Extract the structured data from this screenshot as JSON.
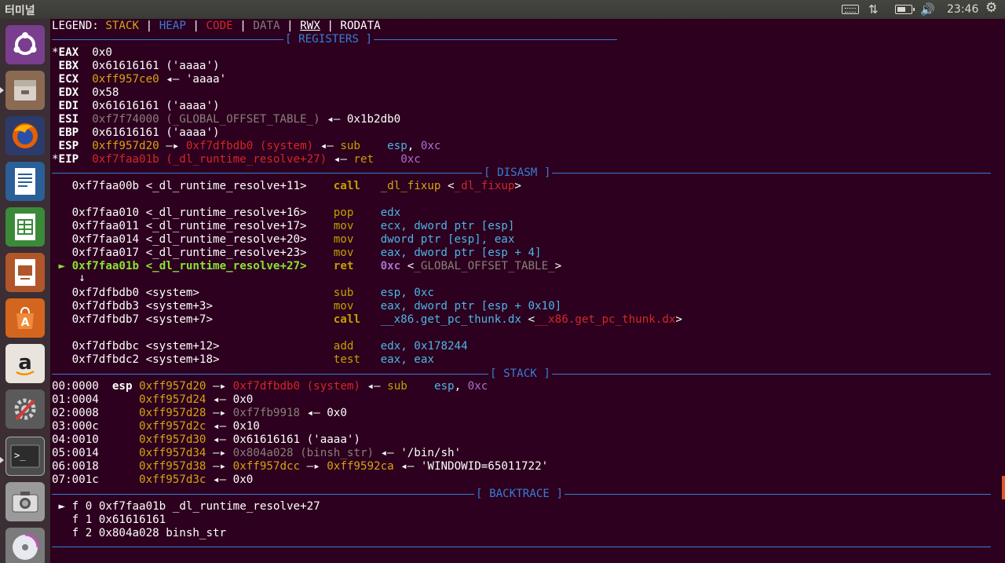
{
  "topbar": {
    "app_title": "터미널",
    "clock": "23:46",
    "icons": [
      "keyboard-icon",
      "network-icon",
      "battery-icon",
      "volume-icon",
      "gear-icon"
    ]
  },
  "launcher": {
    "items": [
      "ubuntu-logo",
      "files",
      "firefox",
      "writer",
      "calc",
      "impress",
      "software-center",
      "amazon",
      "system-settings",
      "terminal",
      "screenshot",
      "dvd"
    ]
  },
  "terminal": {
    "legend": {
      "prefix": "LEGEND:",
      "stack": "STACK",
      "heap": "HEAP",
      "code": "CODE",
      "data": "DATA",
      "rwx": "RWX",
      "rodata": "RODATA",
      "sep": "|"
    },
    "section_titles": {
      "registers": "[ REGISTERS ]",
      "disasm": "[ DISASM ]",
      "stack": "[ STACK ]",
      "backtrace": "[ BACKTRACE ]"
    },
    "registers": [
      {
        "mark": "*",
        "name": "EAX",
        "value": "0x0",
        "rest": ""
      },
      {
        "mark": " ",
        "name": "EBX",
        "value": "0x61616161",
        "rest": " ('aaaa')"
      },
      {
        "mark": " ",
        "name": "ECX",
        "value": "0xff957ce0",
        "arrow": " ◂— ",
        "rest": "'aaaa'"
      },
      {
        "mark": " ",
        "name": "EDX",
        "value": "0x58",
        "rest": ""
      },
      {
        "mark": " ",
        "name": "EDI",
        "value": "0x61616161",
        "rest": " ('aaaa')"
      },
      {
        "mark": " ",
        "name": "ESI",
        "value": "0xf7f74000",
        "sym": " (_GLOBAL_OFFSET_TABLE_)",
        "arrow": " ◂— ",
        "rest": "0x1b2db0"
      },
      {
        "mark": " ",
        "name": "EBP",
        "value": "0x61616161",
        "rest": " ('aaaa')"
      },
      {
        "mark": " ",
        "name": "ESP",
        "value": "0xff957d20",
        "arrow1": " —▸ ",
        "value2": "0xf7dfbdb0 (system)",
        "arrow": " ◂— ",
        "ins": "sub",
        "ops1": "esp",
        "ops2": "0xc"
      },
      {
        "mark": "*",
        "name": "EIP",
        "value": "0xf7faa01b (_dl_runtime_resolve+27)",
        "arrow": " ◂— ",
        "ins": "ret",
        "ops2": "0xc"
      }
    ],
    "disasm": [
      {
        "addr": "0xf7faa00b",
        "sym": "<_dl_runtime_resolve+11>",
        "ins": "call",
        "op": "_dl_fixup",
        "target": "_dl_fixup"
      },
      {
        "addr": "0xf7faa010",
        "sym": "<_dl_runtime_resolve+16>",
        "ins": "pop",
        "op": "edx"
      },
      {
        "addr": "0xf7faa011",
        "sym": "<_dl_runtime_resolve+17>",
        "ins": "mov",
        "op": "ecx, dword ptr [esp]"
      },
      {
        "addr": "0xf7faa014",
        "sym": "<_dl_runtime_resolve+20>",
        "ins": "mov",
        "op": "dword ptr [esp], eax"
      },
      {
        "addr": "0xf7faa017",
        "sym": "<_dl_runtime_resolve+23>",
        "ins": "mov",
        "op": "eax, dword ptr [esp + 4]"
      },
      {
        "addr": "0xf7faa01b",
        "sym": "<_dl_runtime_resolve+27>",
        "ins": "ret",
        "op": "0xc",
        "target": "_GLOBAL_OFFSET_TABLE_"
      },
      {
        "addr": "0xf7dfbdb0",
        "sym": "<system>",
        "ins": "sub",
        "op": "esp, 0xc"
      },
      {
        "addr": "0xf7dfbdb3",
        "sym": "<system+3>",
        "ins": "mov",
        "op": "eax, dword ptr [esp + 0x10]"
      },
      {
        "addr": "0xf7dfbdb7",
        "sym": "<system+7>",
        "ins": "call",
        "op": "__x86.get_pc_thunk.dx",
        "target": "__x86.get_pc_thunk.dx"
      },
      {
        "addr": "0xf7dfbdbc",
        "sym": "<system+12>",
        "ins": "add",
        "op": "edx, 0x178244"
      },
      {
        "addr": "0xf7dfbdc2",
        "sym": "<system+18>",
        "ins": "test",
        "op": "eax, eax"
      }
    ],
    "stack": [
      {
        "idx": "00:0000",
        "reg": "esp",
        "addr": "0xff957d20"
      },
      {
        "idx": "01:0004",
        "reg": "",
        "addr": "0xff957d24",
        "val": "0x0"
      },
      {
        "idx": "02:0008",
        "reg": "",
        "addr": "0xff957d28",
        "val1": "0xf7fb9918",
        "val": "0x0"
      },
      {
        "idx": "03:000c",
        "reg": "",
        "addr": "0xff957d2c",
        "val": "0x10"
      },
      {
        "idx": "04:0010",
        "reg": "",
        "addr": "0xff957d30",
        "val": "0x61616161 ('aaaa')"
      },
      {
        "idx": "05:0014",
        "reg": "",
        "addr": "0xff957d34",
        "val1": "0x804a028 (binsh_str)",
        "val": "'/bin/sh'"
      },
      {
        "idx": "06:0018",
        "reg": "",
        "addr": "0xff957d38",
        "val1": "0xff957dcc",
        "val2": "0xff9592ca",
        "val": "'WINDOWID=65011722'"
      },
      {
        "idx": "07:001c",
        "reg": "",
        "addr": "0xff957d3c",
        "val": "0x0"
      }
    ],
    "backtrace": [
      {
        "marker": "►",
        "frame": "f 0",
        "addr": "0xf7faa01b",
        "sym": "_dl_runtime_resolve+27"
      },
      {
        "marker": " ",
        "frame": "f 1",
        "addr": "0x61616161",
        "sym": ""
      },
      {
        "marker": " ",
        "frame": "f 2",
        "addr": "0x804a028",
        "sym": "binsh_str"
      }
    ],
    "glyphs": {
      "larrow": "◂—",
      "rarrow": "—▸",
      "cur": "►",
      "down": "↓"
    }
  }
}
